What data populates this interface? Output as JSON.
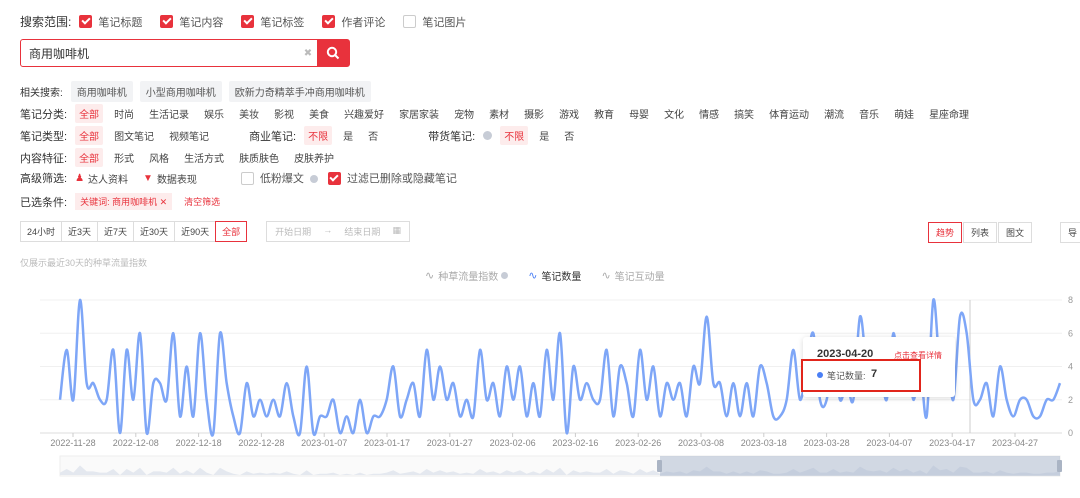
{
  "search_scope": {
    "label": "搜索范围:",
    "options": [
      {
        "label": "笔记标题",
        "checked": true
      },
      {
        "label": "笔记内容",
        "checked": true
      },
      {
        "label": "笔记标签",
        "checked": true
      },
      {
        "label": "作者评论",
        "checked": true
      },
      {
        "label": "笔记图片",
        "checked": false
      }
    ]
  },
  "search": {
    "value": "商用咖啡机"
  },
  "related": {
    "label": "相关搜索:",
    "items": [
      "商用咖啡机",
      "小型商用咖啡机",
      "欧新力奇精萃手冲商用咖啡机"
    ]
  },
  "category": {
    "label": "笔记分类:",
    "items": [
      "全部",
      "时尚",
      "生活记录",
      "娱乐",
      "美妆",
      "影视",
      "美食",
      "兴趣爱好",
      "家居家装",
      "宠物",
      "素材",
      "摄影",
      "游戏",
      "教育",
      "母婴",
      "文化",
      "情感",
      "搞笑",
      "体育运动",
      "潮流",
      "音乐",
      "萌娃",
      "星座命理"
    ]
  },
  "note_type": {
    "label": "笔记类型:",
    "items": [
      "全部",
      "图文笔记",
      "视频笔记"
    ],
    "commercial_label": "商业笔记:",
    "commercial_items": [
      "不限",
      "是",
      "否"
    ],
    "goods_label": "带货笔记:",
    "goods_items": [
      "不限",
      "是",
      "否"
    ]
  },
  "content": {
    "label": "内容特征:",
    "items": [
      "全部",
      "形式",
      "风格",
      "生活方式",
      "肤质肤色",
      "皮肤养护"
    ]
  },
  "advanced": {
    "label": "高级筛选:",
    "items": [
      "达人资料",
      "数据表现"
    ],
    "low_fan": "低粉爆文",
    "filter_deleted": "过滤已删除或隐藏笔记"
  },
  "selected": {
    "label": "已选条件:",
    "chip": "关键词: 商用咖啡机",
    "clear": "清空筛选"
  },
  "time_range": {
    "items": [
      "24小时",
      "近3天",
      "近7天",
      "近30天",
      "近90天",
      "全部"
    ],
    "selected": "全部"
  },
  "date": {
    "start": "开始日期",
    "arrow": "→",
    "end": "结束日期"
  },
  "view": {
    "items": [
      "趋势",
      "列表",
      "图文"
    ],
    "selected": "趋势",
    "export": "导"
  },
  "note_hint": "仅展示最近30天的种草流量指数",
  "colors": {
    "accent": "#e8323c",
    "line": "#7ea6f7",
    "line_dim": "#c9d8f8"
  },
  "tooltip": {
    "date": "2023-04-20",
    "link": "点击查看详情",
    "series_label": "笔记数量:",
    "value": "7"
  },
  "chart_data": {
    "type": "line",
    "legend": [
      "种草流量指数",
      "笔记数量",
      "笔记互动量"
    ],
    "active_series": "笔记数量",
    "x_tick_labels": [
      "2022-11-28",
      "2022-12-08",
      "2022-12-18",
      "2022-12-28",
      "2023-01-07",
      "2023-01-17",
      "2023-01-27",
      "2023-02-06",
      "2023-02-16",
      "2023-02-26",
      "2023-03-08",
      "2023-03-18",
      "2023-03-28",
      "2023-04-07",
      "2023-04-17",
      "2023-04-27"
    ],
    "y_ticks": [
      0,
      2,
      4,
      6,
      8
    ],
    "ylim": [
      0,
      8
    ],
    "start_date": "2022-11-28",
    "end_date": "2023-05-02",
    "series": [
      {
        "name": "笔记数量",
        "values": [
          2,
          5,
          2,
          8,
          3,
          3,
          2,
          2,
          5,
          0,
          5,
          2,
          6,
          0,
          3,
          3,
          2,
          6,
          1,
          4,
          1,
          6,
          2,
          0,
          6,
          3,
          1,
          0,
          3,
          1,
          2,
          1,
          2,
          1,
          3,
          1,
          0,
          4,
          0,
          1,
          1,
          2,
          0,
          1,
          0,
          2,
          0,
          1,
          1,
          2,
          4,
          1,
          2,
          3,
          1,
          5,
          2,
          4,
          2,
          3,
          1,
          2,
          1,
          5,
          2,
          3,
          1,
          4,
          2,
          4,
          1,
          3,
          1,
          5,
          2,
          6,
          0,
          4,
          2,
          3,
          2,
          2,
          5,
          1,
          4,
          3,
          1,
          5,
          2,
          4,
          1,
          3,
          2,
          3,
          1,
          4,
          3,
          7,
          3,
          3,
          1,
          3,
          1,
          3,
          1,
          4,
          3,
          1,
          1,
          2,
          5,
          2,
          4,
          6,
          2,
          2,
          5,
          2,
          3,
          2,
          7,
          4,
          3,
          4,
          2,
          6,
          3,
          5,
          2,
          4,
          1,
          8,
          4,
          5,
          2,
          7,
          6,
          2,
          2,
          3,
          1,
          4,
          2,
          1,
          2,
          2,
          1,
          1,
          2,
          2,
          3
        ]
      }
    ]
  }
}
